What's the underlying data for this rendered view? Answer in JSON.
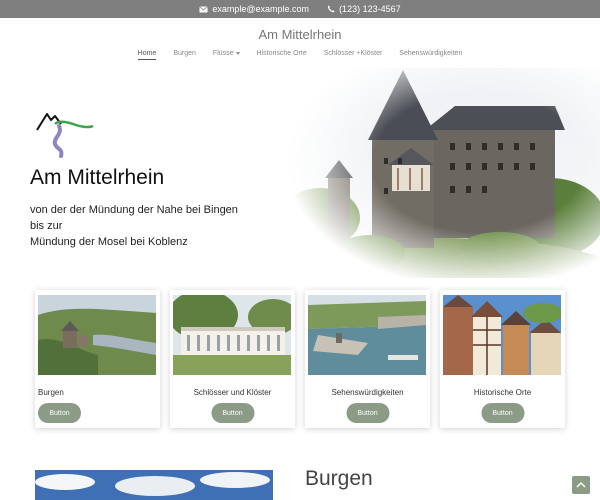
{
  "topbar": {
    "email": "example@example.com",
    "phone": "(123) 123-4567"
  },
  "site": {
    "title": "Am Mittelrhein"
  },
  "nav": {
    "items": [
      "Home",
      "Burgen",
      "Flüsse",
      "Historische Orte",
      "Schlösser +Klöster",
      "Sehenswürdigkeiten"
    ],
    "active": "Home"
  },
  "hero": {
    "title": "Am Mittelrhein",
    "subtitle_lines": [
      "von der der Mündung der Nahe bei Bingen",
      "bis zur",
      "Mündung der Mosel bei Koblenz"
    ]
  },
  "cards": [
    {
      "label": "Burgen",
      "button": "Button"
    },
    {
      "label": "Schlösser und Klöster",
      "button": "Button"
    },
    {
      "label": "Sehenswürdigkeiten",
      "button": "Button"
    },
    {
      "label": "Historische Orte",
      "button": "Button"
    }
  ],
  "section": {
    "heading": "Burgen"
  },
  "colors": {
    "accent": "#8b9b86",
    "topbar": "#7f7f7f"
  }
}
